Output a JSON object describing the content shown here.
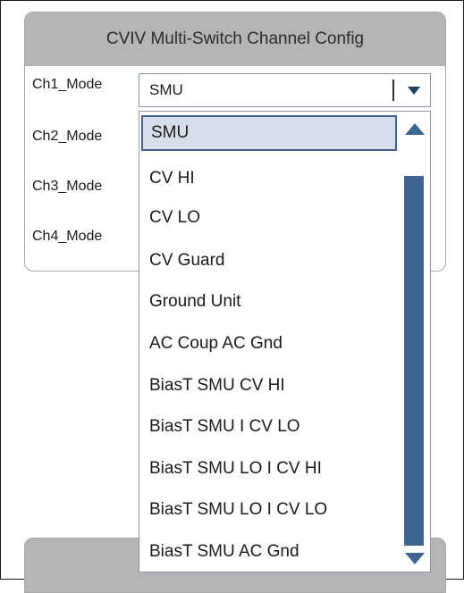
{
  "panel": {
    "title": "CVIV Multi-Switch Channel Config"
  },
  "channels": [
    {
      "label": "Ch1_Mode",
      "value": "SMU"
    },
    {
      "label": "Ch2_Mode"
    },
    {
      "label": "Ch3_Mode"
    },
    {
      "label": "Ch4_Mode"
    }
  ],
  "dropdown": {
    "selected_index": 0,
    "options": [
      "SMU",
      "CV HI",
      "CV LO",
      "CV Guard",
      "Ground Unit",
      "AC Coup AC Gnd",
      "BiasT SMU CV HI",
      "BiasT SMU I CV LO",
      "BiasT SMU LO I CV HI",
      "BiasT SMU LO I CV LO",
      "BiasT SMU AC Gnd"
    ]
  },
  "icons": {
    "combo_arrow": "chevron-down-icon",
    "scroll_up": "scroll-up-arrow-icon",
    "scroll_down": "scroll-down-arrow-icon"
  },
  "colors": {
    "panel_header": "#b5b5b5",
    "selected_item_bg": "#d6deec",
    "selected_item_border": "#44618f",
    "scrollbar_thumb": "#3f6691"
  }
}
